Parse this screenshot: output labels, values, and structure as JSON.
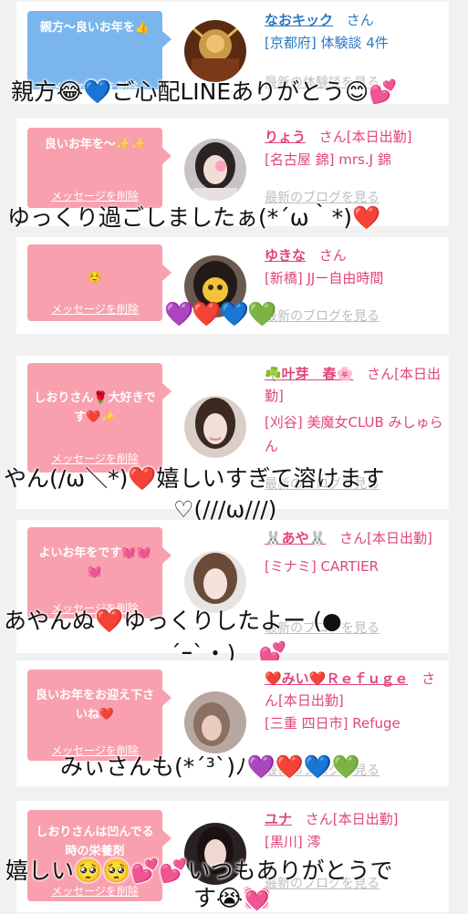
{
  "entries": [
    {
      "bubble": "親方〜良いお年を👍",
      "delete": "メッセージを削除",
      "name": "なおキック",
      "suffix": "さん",
      "shop": "[京都府] 体験談 4件",
      "more": "最新の体験談を見る",
      "overlay": [
        "親方😂💙ご心配LINEありがとう😊💕"
      ]
    },
    {
      "bubble": "良いお年を〜✨✨",
      "delete": "メッセージを削除",
      "name": "りょう",
      "suffix": "さん[本日出勤]",
      "shop": "[名古屋 錦] mrs.J 錦",
      "more": "最新のブログを見る",
      "overlay": [
        "ゆっくり過ごしましたぁ(*´ω｀*)❤️"
      ]
    },
    {
      "bubble": "☺️",
      "delete": "メッセージを削除",
      "name": "ゆきな",
      "suffix": "さん",
      "shop": "[新橋] JJー自由時間",
      "more": "最新のブログを見る",
      "hearts": "💜❤️💙💚"
    },
    {
      "bubble": "しおりさん🌹大好きです❤️✨",
      "delete": "メッセージを削除",
      "name": "☘️叶芽　春🌸",
      "suffix": "さん[本日出勤]",
      "shop": "[刈谷] 美魔女CLUB みしゅらん",
      "more": "最新のブログを見る",
      "overlay": [
        "やん(/ω＼*)❤️嬉しいすぎて溶けます",
        "♡(///ω///)"
      ]
    },
    {
      "bubble": "よいお年をです💓💓💓",
      "delete": "メッセージを削除",
      "name": "🐰あや🐰",
      "suffix": "さん[本日出勤]",
      "shop": "[ミナミ] CARTIER",
      "more": "最新のブログを見る",
      "overlay": [
        "あやんぬ❤️ゆっくりしたよー (●",
        "´ｰ`・)　💕"
      ]
    },
    {
      "bubble": "良いお年をお迎え下さいね❤️",
      "delete": "メッセージを削除",
      "name": "❤️みい❤️Ｒｅｆｕｇｅ",
      "suffix": "さん[本日出勤]",
      "shop": "[三重 四日市] Refuge",
      "more": "最新のブログを見る",
      "overlay": [
        "みぃさんも(*´³`)ﾉ💜❤️💙💚"
      ]
    },
    {
      "bubble": "しおりさんは凹んでる時の栄養剤",
      "delete": "メッセージを削除",
      "name": "ユナ",
      "suffix": "さん[本日出勤]",
      "shop": "[黒川] 澪",
      "more": "最新のブログを見る",
      "overlay": [
        "嬉しい🥺🥺💕💕いつもありがとうで",
        "す😭💓"
      ]
    }
  ]
}
